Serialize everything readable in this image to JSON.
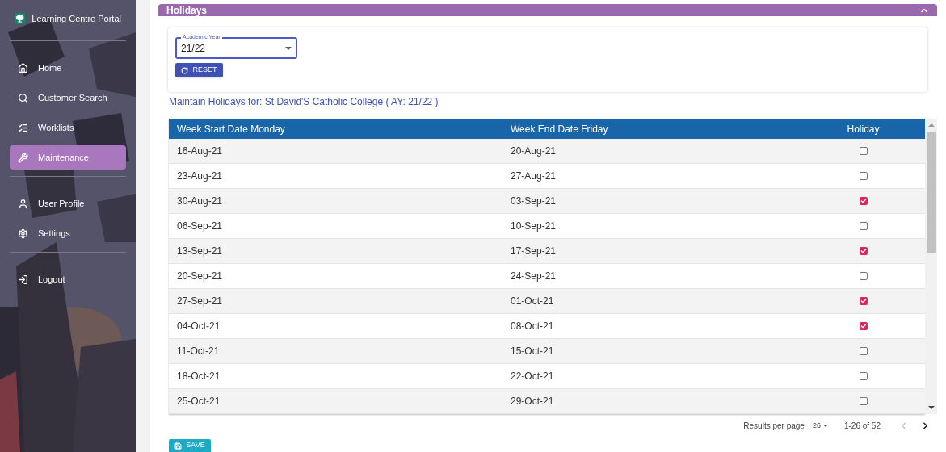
{
  "sidebar": {
    "title": "Learning Centre Portal",
    "groups": [
      {
        "items": [
          {
            "label": "Home",
            "kind": "home",
            "selected": false
          },
          {
            "label": "Customer Search",
            "kind": "search",
            "selected": false
          },
          {
            "label": "Worklists",
            "kind": "list",
            "selected": false
          },
          {
            "label": "Maintenance",
            "kind": "wrench",
            "selected": true
          }
        ]
      },
      {
        "items": [
          {
            "label": "User Profile",
            "kind": "user",
            "selected": false
          },
          {
            "label": "Settings",
            "kind": "settings",
            "selected": false
          }
        ]
      },
      {
        "items": [
          {
            "label": "Logout",
            "kind": "logout",
            "selected": false
          }
        ]
      }
    ]
  },
  "panel": {
    "title": "Holidays",
    "expanded": true
  },
  "filter": {
    "label": "Academic Year",
    "value": "21/22",
    "reset": "RESET"
  },
  "heading": "Maintain Holidays for: St David'S Catholic College ( AY: 21/22 )",
  "table": {
    "columns": [
      "Week Start Date Monday",
      "Week End Date Friday",
      "Holiday"
    ],
    "rows": [
      {
        "start": "16-Aug-21",
        "end": "20-Aug-21",
        "holiday": false
      },
      {
        "start": "23-Aug-21",
        "end": "27-Aug-21",
        "holiday": false
      },
      {
        "start": "30-Aug-21",
        "end": "03-Sep-21",
        "holiday": true
      },
      {
        "start": "06-Sep-21",
        "end": "10-Sep-21",
        "holiday": false
      },
      {
        "start": "13-Sep-21",
        "end": "17-Sep-21",
        "holiday": true
      },
      {
        "start": "20-Sep-21",
        "end": "24-Sep-21",
        "holiday": false
      },
      {
        "start": "27-Sep-21",
        "end": "01-Oct-21",
        "holiday": true
      },
      {
        "start": "04-Oct-21",
        "end": "08-Oct-21",
        "holiday": true
      },
      {
        "start": "11-Oct-21",
        "end": "15-Oct-21",
        "holiday": false
      },
      {
        "start": "18-Oct-21",
        "end": "22-Oct-21",
        "holiday": false
      },
      {
        "start": "25-Oct-21",
        "end": "29-Oct-21",
        "holiday": false
      }
    ]
  },
  "pagination": {
    "label": "Results per page",
    "per_page": "26",
    "range": "1-26 of 52",
    "prev_disabled": true,
    "next_disabled": false
  },
  "save": "SAVE"
}
